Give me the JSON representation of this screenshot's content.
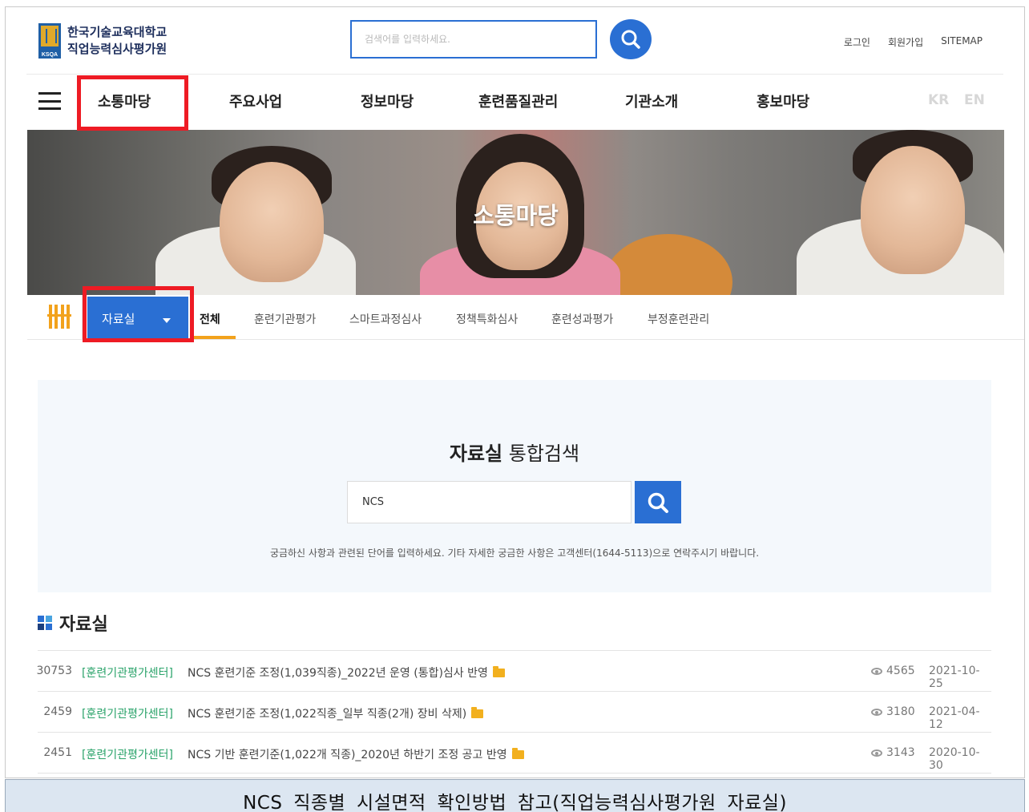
{
  "header": {
    "logo_line1": "한국기술교육대학교",
    "logo_line2": "직업능력심사평가원",
    "logo_badge": "KSQA",
    "search_placeholder": "검색어를 입력하세요.",
    "util_links": [
      "로그인",
      "회원가입",
      "SITEMAP"
    ]
  },
  "gnb": {
    "items": [
      "소통마당",
      "주요사업",
      "정보마당",
      "훈련품질관리",
      "기관소개",
      "홍보마당"
    ],
    "lang": [
      "KR",
      "EN"
    ]
  },
  "banner": {
    "title": "소통마당"
  },
  "subnav": {
    "selected": "자료실",
    "tabs": [
      "전체",
      "훈련기관평가",
      "스마트과정심사",
      "정책특화심사",
      "훈련성과평가",
      "부정훈련관리"
    ]
  },
  "search_panel": {
    "title_strong": "자료실",
    "title_rest": " 통합검색",
    "query": "NCS",
    "help": "궁금하신 사항과 관련된 단어를 입력하세요. 기타 자세한 궁금한 사항은 고객센터(1644-5113)으로 연락주시기 바랍니다."
  },
  "list": {
    "heading": "자료실",
    "rows": [
      {
        "num": "30753",
        "cat": "[훈련기관평가센터]",
        "title": "NCS 훈련기준 조정(1,039직종)_2022년 운영 (통합)심사 반영",
        "views": "4565",
        "date": "2021-10-25"
      },
      {
        "num": "2459",
        "cat": "[훈련기관평가센터]",
        "title": "NCS 훈련기준 조정(1,022직종_일부 직종(2개) 장비 삭제)",
        "views": "3180",
        "date": "2021-04-12"
      },
      {
        "num": "2451",
        "cat": "[훈련기관평가센터]",
        "title": "NCS 기반 훈련기준(1,022개 직종)_2020년 하반기 조정 공고 반영",
        "views": "3143",
        "date": "2020-10-30"
      }
    ]
  },
  "caption": "NCS 직종별 시설면적 확인방법 참고(직업능력심사평가원 자료실)",
  "colors": {
    "accent_blue": "#2a6fd3",
    "highlight_red": "#ee1b24",
    "category_green": "#2aa36a",
    "tab_underline": "#f2a21c"
  }
}
